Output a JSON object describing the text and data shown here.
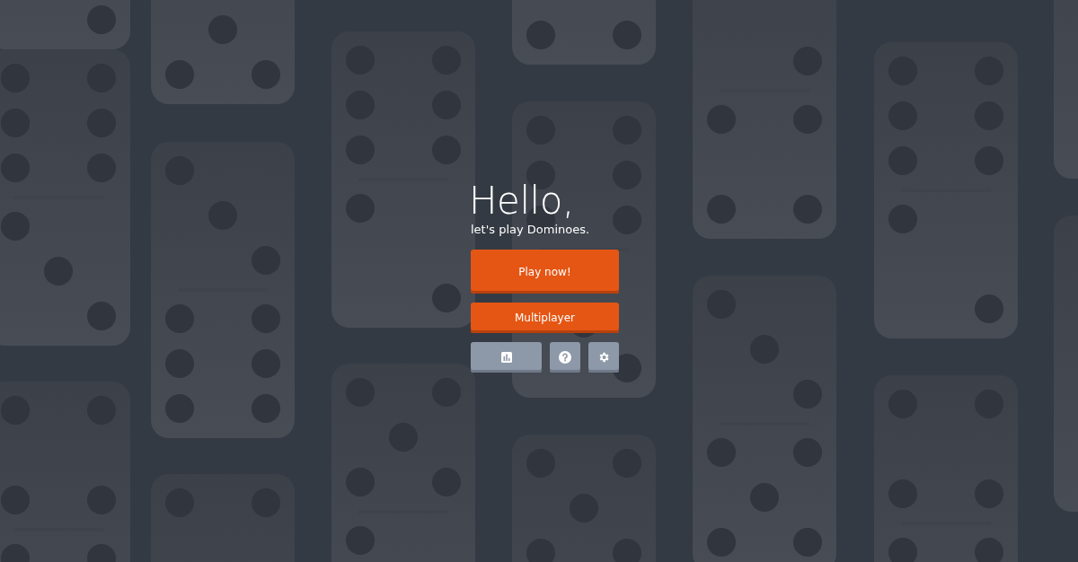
{
  "heading": "Hello,",
  "subheading": "let's play Dominoes.",
  "buttons": [
    {
      "label": "Play now!",
      "kind": "primary"
    },
    {
      "label": "Multiplayer",
      "kind": "primary"
    }
  ],
  "icon_buttons": [
    {
      "kind": "stats"
    },
    {
      "kind": "help"
    },
    {
      "kind": "settings"
    }
  ]
}
